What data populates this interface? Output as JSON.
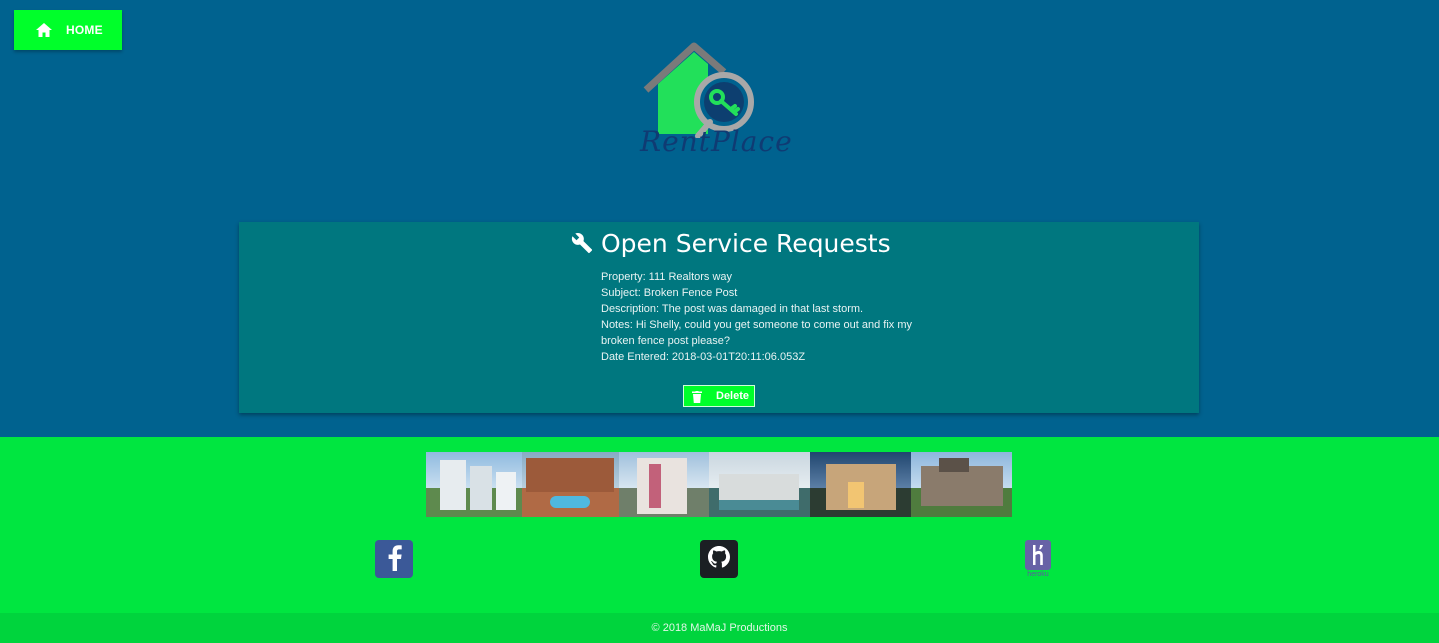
{
  "nav": {
    "home_label": "HOME",
    "home_icon": "home-icon"
  },
  "logo": {
    "text": "RentPlace"
  },
  "panel": {
    "title": "Open Service Requests",
    "title_icon": "wrench-icon",
    "request": {
      "property": "Property: 111 Realtors way",
      "subject": "Subject: Broken Fence Post",
      "description": "Description: The post was damaged in that last storm.",
      "notes": "Notes: Hi Shelly, could you get someone to come out and fix my broken fence post please?",
      "date_entered": "Date Entered: 2018-03-01T20:11:06.053Z"
    },
    "delete_label": "Delete",
    "delete_icon": "trash-icon"
  },
  "footer": {
    "social": [
      "facebook-icon",
      "github-icon",
      "heroku-icon"
    ],
    "heroku_word": "heroku",
    "copyright": "© 2018 MaMaJ Productions"
  },
  "colors": {
    "page_bg": "#00628f",
    "panel_bg": "#00777f",
    "accent_green": "#00ff2a",
    "footer_bg": "#00e640",
    "copyright_bg": "#00d43d"
  }
}
